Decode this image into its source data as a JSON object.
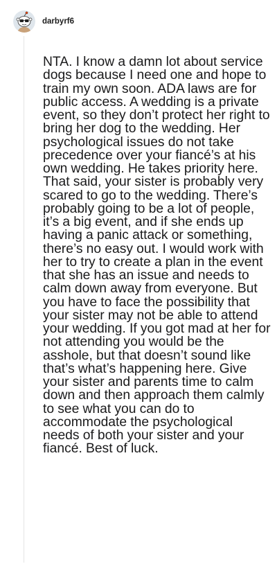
{
  "comment": {
    "avatar_icon": "snoo-avatar-icon",
    "username": "darbyrf6",
    "body": "NTA. I know a damn lot about service dogs because I need one and hope to train my own soon. ADA laws are for public access. A wedding is a private event, so they don’t protect her right to bring her dog to the wedding. Her psychological issues do not take precedence over your fiancé’s at his own wedding. He takes priority here. That said, your sister is probably very scared to go to the wedding. There’s probably going to be a lot of people, it’s a big event, and if she ends up having a panic attack or something, there’s no easy out. I would work with her to try to create a plan in the event that she has an issue and needs to calm down away from everyone. But you have to face the possibility that your sister may not be able to attend your wedding. If you got mad at her for not attending you would be the asshole, but that doesn’t sound like that’s what’s happening here. Give your sister and parents time to calm down and then approach them calmly to see what you can do to accommodate the psychological needs of both your sister and your fiancé. Best of luck."
  }
}
